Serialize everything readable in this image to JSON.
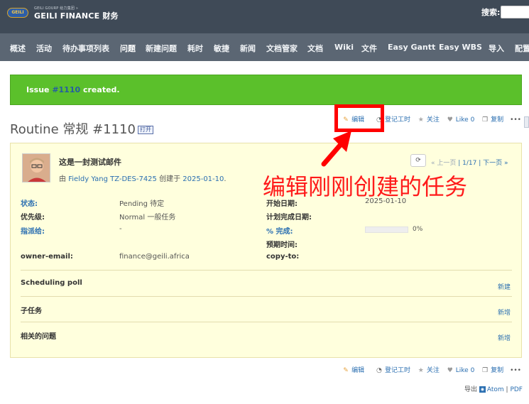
{
  "header": {
    "logo_text": "GEILI",
    "brand_small": "GEILI GOURP 给力集团 »",
    "brand_main": "GEILI FINANCE 财务",
    "search_label": "搜索:"
  },
  "menu": {
    "items": [
      "概述",
      "活动",
      "待办事项列表",
      "问题",
      "新建问题",
      "耗时",
      "敏捷",
      "新闻",
      "文档管家",
      "文档",
      "Wiki",
      "文件",
      "Easy Gantt",
      "Easy WBS",
      "导入",
      "配置"
    ]
  },
  "flash": {
    "prefix": "Issue ",
    "issue_link": "#1110",
    "suffix": " created."
  },
  "issue": {
    "title": "Routine 常规 #1110",
    "private_tag": "打开",
    "subject": "这是一封测试邮件",
    "author_prefix": "由 ",
    "author": "Fieldy Yang TZ-DES-7425",
    "created_prefix": " 创建于 ",
    "created_date": "2025-01-10",
    "created_suffix": ".",
    "pager_prev": "« 上一页",
    "pager_sep1": " | ",
    "pager_pos": "1/17",
    "pager_sep2": " | ",
    "pager_next": "下一页 »",
    "nav_icon": "⟳"
  },
  "actions": {
    "edit": "编辑",
    "log_time": "登记工时",
    "watch": "关注",
    "like": "Like",
    "like_count": "0",
    "copy": "复制",
    "more": "•••"
  },
  "attributes": {
    "status_label": "状态:",
    "status_value": "Pending 待定",
    "priority_label": "优先级:",
    "priority_value": "Normal 一般任务",
    "assignee_label": "指派给:",
    "assignee_value": "-",
    "start_label": "开始日期:",
    "start_value": "2025-01-10",
    "due_label": "计划完成日期:",
    "done_label": "% 完成:",
    "done_value": "0%",
    "done_fraction": 0,
    "estimated_label": "预期时间:",
    "owner_email_label": "owner-email:",
    "owner_email_value": "finance@geili.africa",
    "copy_to_label": "copy-to:"
  },
  "sections": {
    "scheduling": "Scheduling poll",
    "scheduling_action": "新建",
    "subtasks": "子任务",
    "subtasks_action": "新增",
    "related": "相关的问题",
    "related_action": "新增"
  },
  "annotation": {
    "text": "编辑刚刚创建的任务"
  },
  "export": {
    "label": "导出",
    "atom": "Atom",
    "sep": " | ",
    "pdf": "PDF"
  },
  "colors": {
    "topbar": "#3f4a57",
    "menubar": "#5b6673",
    "flash": "#5bc02b",
    "link": "#2b6fb1",
    "panel": "#ffffdd",
    "annotation": "#ff1a1a"
  }
}
